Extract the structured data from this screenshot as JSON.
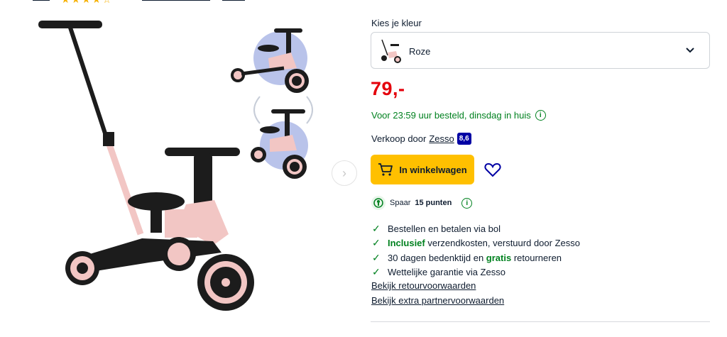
{
  "variant": {
    "label": "Kies je kleur",
    "selected": "Roze"
  },
  "price": "79,-",
  "delivery": {
    "text": "Voor 23:59 uur besteld, dinsdag in huis",
    "info_icon": "info-icon"
  },
  "seller": {
    "prefix": "Verkoop door",
    "name": "Zesso",
    "score": "8,6"
  },
  "cart_button": {
    "label": "In winkelwagen",
    "icon": "cart-icon"
  },
  "wishlist_icon": "heart-icon",
  "points": {
    "prefix": "Spaar",
    "amount": "15 punten"
  },
  "usps": [
    {
      "pre": "",
      "hl": "",
      "post": "Bestellen en betalen via bol"
    },
    {
      "pre": "",
      "hl": "Inclusief",
      "post": " verzendkosten, verstuurd door Zesso"
    },
    {
      "pre": "30 dagen bedenktijd en ",
      "hl": "gratis",
      "post": " retourneren"
    },
    {
      "pre": "",
      "hl": "",
      "post": "Wettelijke garantie via Zesso"
    }
  ],
  "links": {
    "returns": "Bekijk retourvoorwaarden",
    "partner": "Bekijk extra partnervoorwaarden"
  },
  "colors": {
    "price_red": "#e4000b",
    "green": "#00811f",
    "cart_yellow": "#ffc000",
    "score_blue": "#0000a4",
    "bike_pink": "#f2c6c4"
  }
}
